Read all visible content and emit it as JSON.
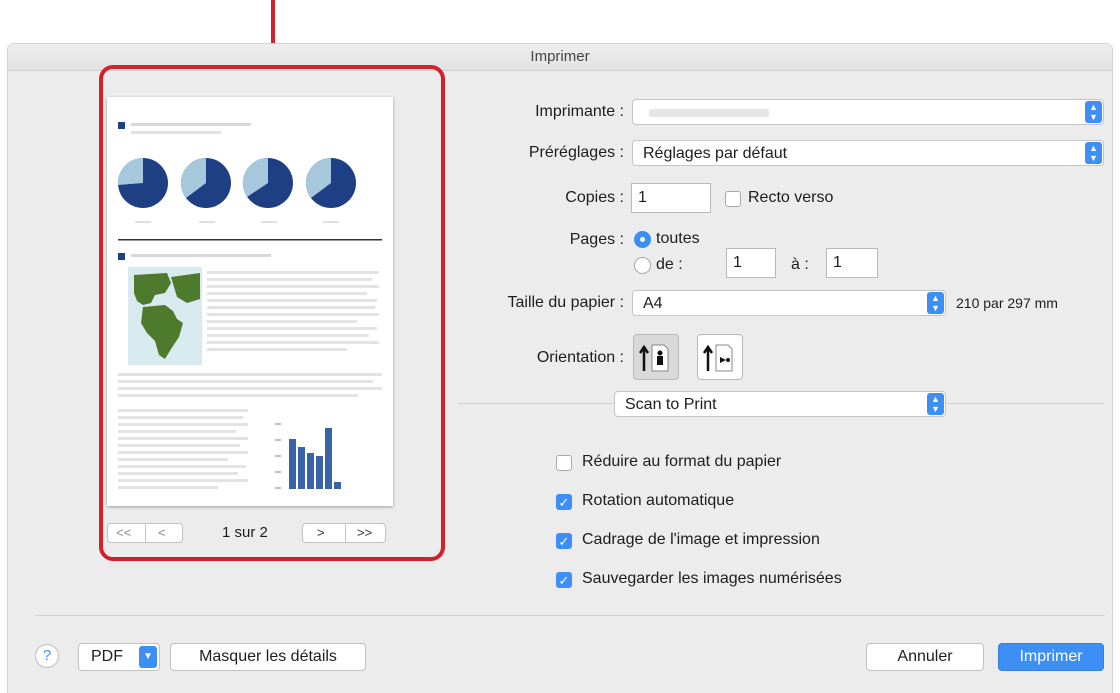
{
  "window": {
    "title": "Imprimer"
  },
  "preview": {
    "page_indicator": "1 sur 2",
    "nav": {
      "first": "<<",
      "prev": "<",
      "next": ">",
      "last": ">>"
    }
  },
  "printer": {
    "label": "Imprimante :",
    "value": ""
  },
  "presets": {
    "label": "Préréglages :",
    "value": "Réglages par défaut"
  },
  "copies": {
    "label": "Copies :",
    "value": "1",
    "duplex_label": "Recto verso",
    "duplex_checked": false
  },
  "pages": {
    "label": "Pages :",
    "all_label": "toutes",
    "from_label": "de :",
    "from_value": "1",
    "to_label": "à :",
    "to_value": "1",
    "selected": "toutes"
  },
  "paper_size": {
    "label": "Taille du papier :",
    "value": "A4",
    "dimensions": "210 par 297 mm"
  },
  "orientation": {
    "label": "Orientation :",
    "selected": "portrait"
  },
  "section_popup": {
    "value": "Scan to Print"
  },
  "options": [
    {
      "label": "Réduire au format du papier",
      "checked": false
    },
    {
      "label": "Rotation automatique",
      "checked": true
    },
    {
      "label": "Cadrage de l'image et impression",
      "checked": true
    },
    {
      "label": "Sauvegarder les images numérisées",
      "checked": true
    }
  ],
  "footer": {
    "help": "?",
    "pdf_label": "PDF",
    "hide_details": "Masquer les détails",
    "cancel": "Annuler",
    "print": "Imprimer"
  },
  "colors": {
    "accent": "#3d8ff5",
    "highlight": "#d4202a",
    "chart_dark": "#1f3f85",
    "chart_light": "#a7c8dc",
    "map_green": "#4e7a2d"
  }
}
